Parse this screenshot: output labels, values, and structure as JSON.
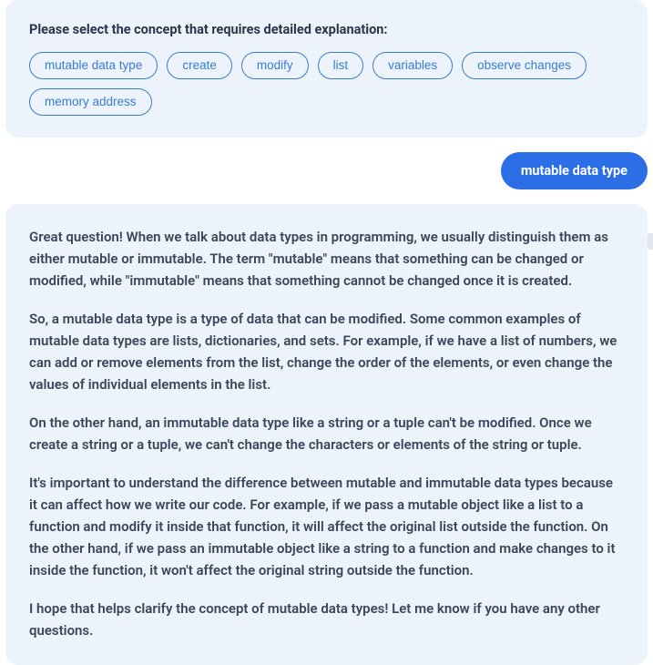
{
  "concept_prompt": {
    "title": "Please select the concept that requires detailed explanation:",
    "chips": [
      "mutable data type",
      "create",
      "modify",
      "list",
      "variables",
      "observe changes",
      "memory address"
    ]
  },
  "user_message": {
    "text": "mutable data type"
  },
  "assistant_answer": {
    "paragraphs": [
      "Great question! When we talk about data types in programming, we usually distinguish them as either mutable or immutable. The term \"mutable\" means that something can be changed or modified, while \"immutable\" means that something cannot be changed once it is created.",
      "So, a mutable data type is a type of data that can be modified. Some common examples of mutable data types are lists, dictionaries, and sets. For example, if we have a list of numbers, we can add or remove elements from the list, change the order of the elements, or even change the values of individual elements in the list.",
      "On the other hand, an immutable data type like a string or a tuple can't be modified. Once we create a string or a tuple, we can't change the characters or elements of the string or tuple.",
      "It's important to understand the difference between mutable and immutable data types because it can affect how we write our code. For example, if we pass a mutable object like a list to a function and modify it inside that function, it will affect the original list outside the function. On the other hand, if we pass an immutable object like a string to a function and make changes to it inside the function, it won't affect the original string outside the function.",
      "I hope that helps clarify the concept of mutable data types! Let me know if you have any other questions."
    ]
  }
}
